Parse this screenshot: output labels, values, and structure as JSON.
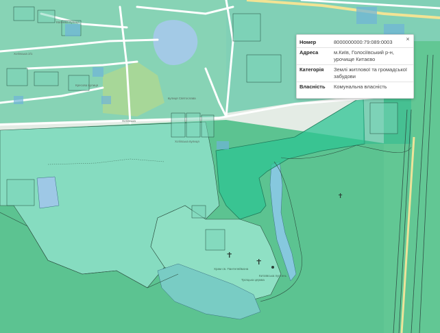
{
  "map": {
    "colors": {
      "forest": "#5cc391",
      "parcel": "#8fe0c4",
      "parcel_dark": "#37c995",
      "residential": "#2fba8f",
      "water": "#a3cae6",
      "road": "#ffffff",
      "highlight": "#2ec493"
    },
    "street_labels": [
      "Хотівська",
      "Хотівська вулиця",
      "Квітнева вулиця",
      "вулиця Святослава",
      "Кресова вулиця",
      "Хотівська 2/1"
    ],
    "poi_labels": [
      "Храм св. Пантелеймона",
      "Китаївська пустинь",
      "Троїцька церква"
    ]
  },
  "popup": {
    "close_label": "×",
    "rows": [
      {
        "key": "Номер",
        "value": "8000000000:79:089:0003"
      },
      {
        "key": "Адреса",
        "value": "м.Київ, Голосіївський р-н, урочище Китаєво"
      },
      {
        "key": "Категорія",
        "value": "Землі житлової та громадської забудови"
      },
      {
        "key": "Власність",
        "value": "Комунальна власність"
      }
    ]
  }
}
